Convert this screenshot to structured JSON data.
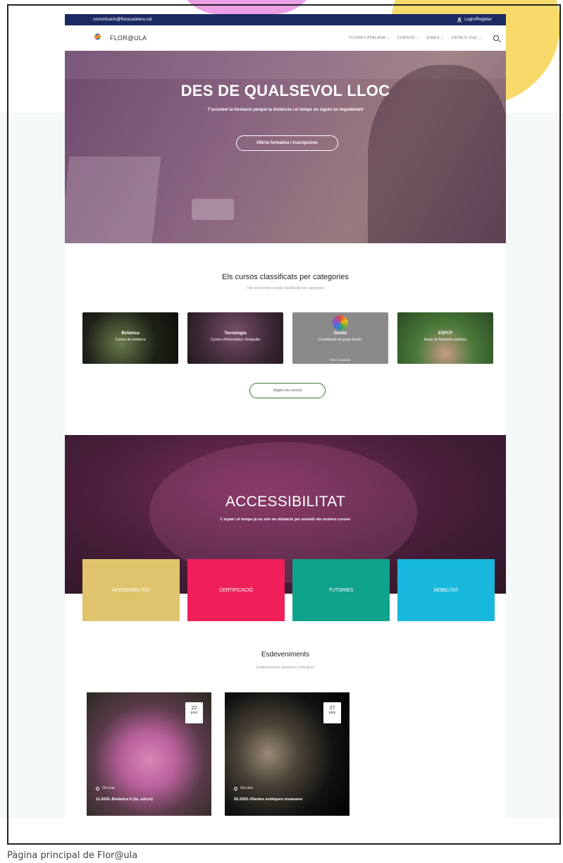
{
  "topbar": {
    "email": "comunicacio@floracatalana.cat",
    "login_label": "Login/Register"
  },
  "nav": {
    "brand": "FLOR@ULA",
    "menu": [
      "FLORA CATALANA",
      "CURSOS",
      "EINES",
      "CATALÀ (CA)"
    ]
  },
  "hero": {
    "title": "DES DE QUALSEVOL LLOC",
    "subtitle": "T'acostem la formació perquè la distància i el temps no siguin un impediment",
    "button": "Oferta formativa i inscripcions"
  },
  "categories": {
    "title": "Els cursos classificats per categories",
    "subtitle": "Tots els nostres cursos classificats per categories",
    "items": [
      {
        "title": "Botànica",
        "desc": "Cursos de botànica"
      },
      {
        "title": "Tecnologia",
        "desc": "Cursos d'informàtica i fotografia"
      },
      {
        "title": "Gestió",
        "desc": "coordinació de grups locals.",
        "extra": "Flora Catalana"
      },
      {
        "title": "ESPCP",
        "desc": "Espai de formació continua"
      }
    ],
    "button": "Veges els cursos"
  },
  "accessibility": {
    "title": "ACCESSIBILITAT",
    "subtitle": "L'espai i el temps ja no són un obstacle per assistir als nostres cursos",
    "tiles": [
      "ACCESSIBILITAT",
      "CERTIFICACIÓ",
      "TUTORIES",
      "MOBILITAT"
    ]
  },
  "events": {
    "title": "Esdeveniments",
    "subtitle": "Esdeveniments previstos a Flor@ula",
    "items": [
      {
        "day": "22",
        "month": "juny",
        "location": "On-Line",
        "name": "11.2020.-Botànica II (2a. edició)"
      },
      {
        "day": "27",
        "month": "juny",
        "location": "On-Line",
        "name": "05.2020.-Plantes exòtiques invasores"
      }
    ]
  },
  "caption": "Pàgina principal de Flor@ula",
  "colors": {
    "topbar": "#1c2a63",
    "tile_accessibilitat": "#dfc46d",
    "tile_certificacio": "#f01f5a",
    "tile_tutories": "#10a38b",
    "tile_mobilitat": "#18b8de",
    "blob_pink": "#e88fe0",
    "blob_yellow": "#f7da6a"
  }
}
